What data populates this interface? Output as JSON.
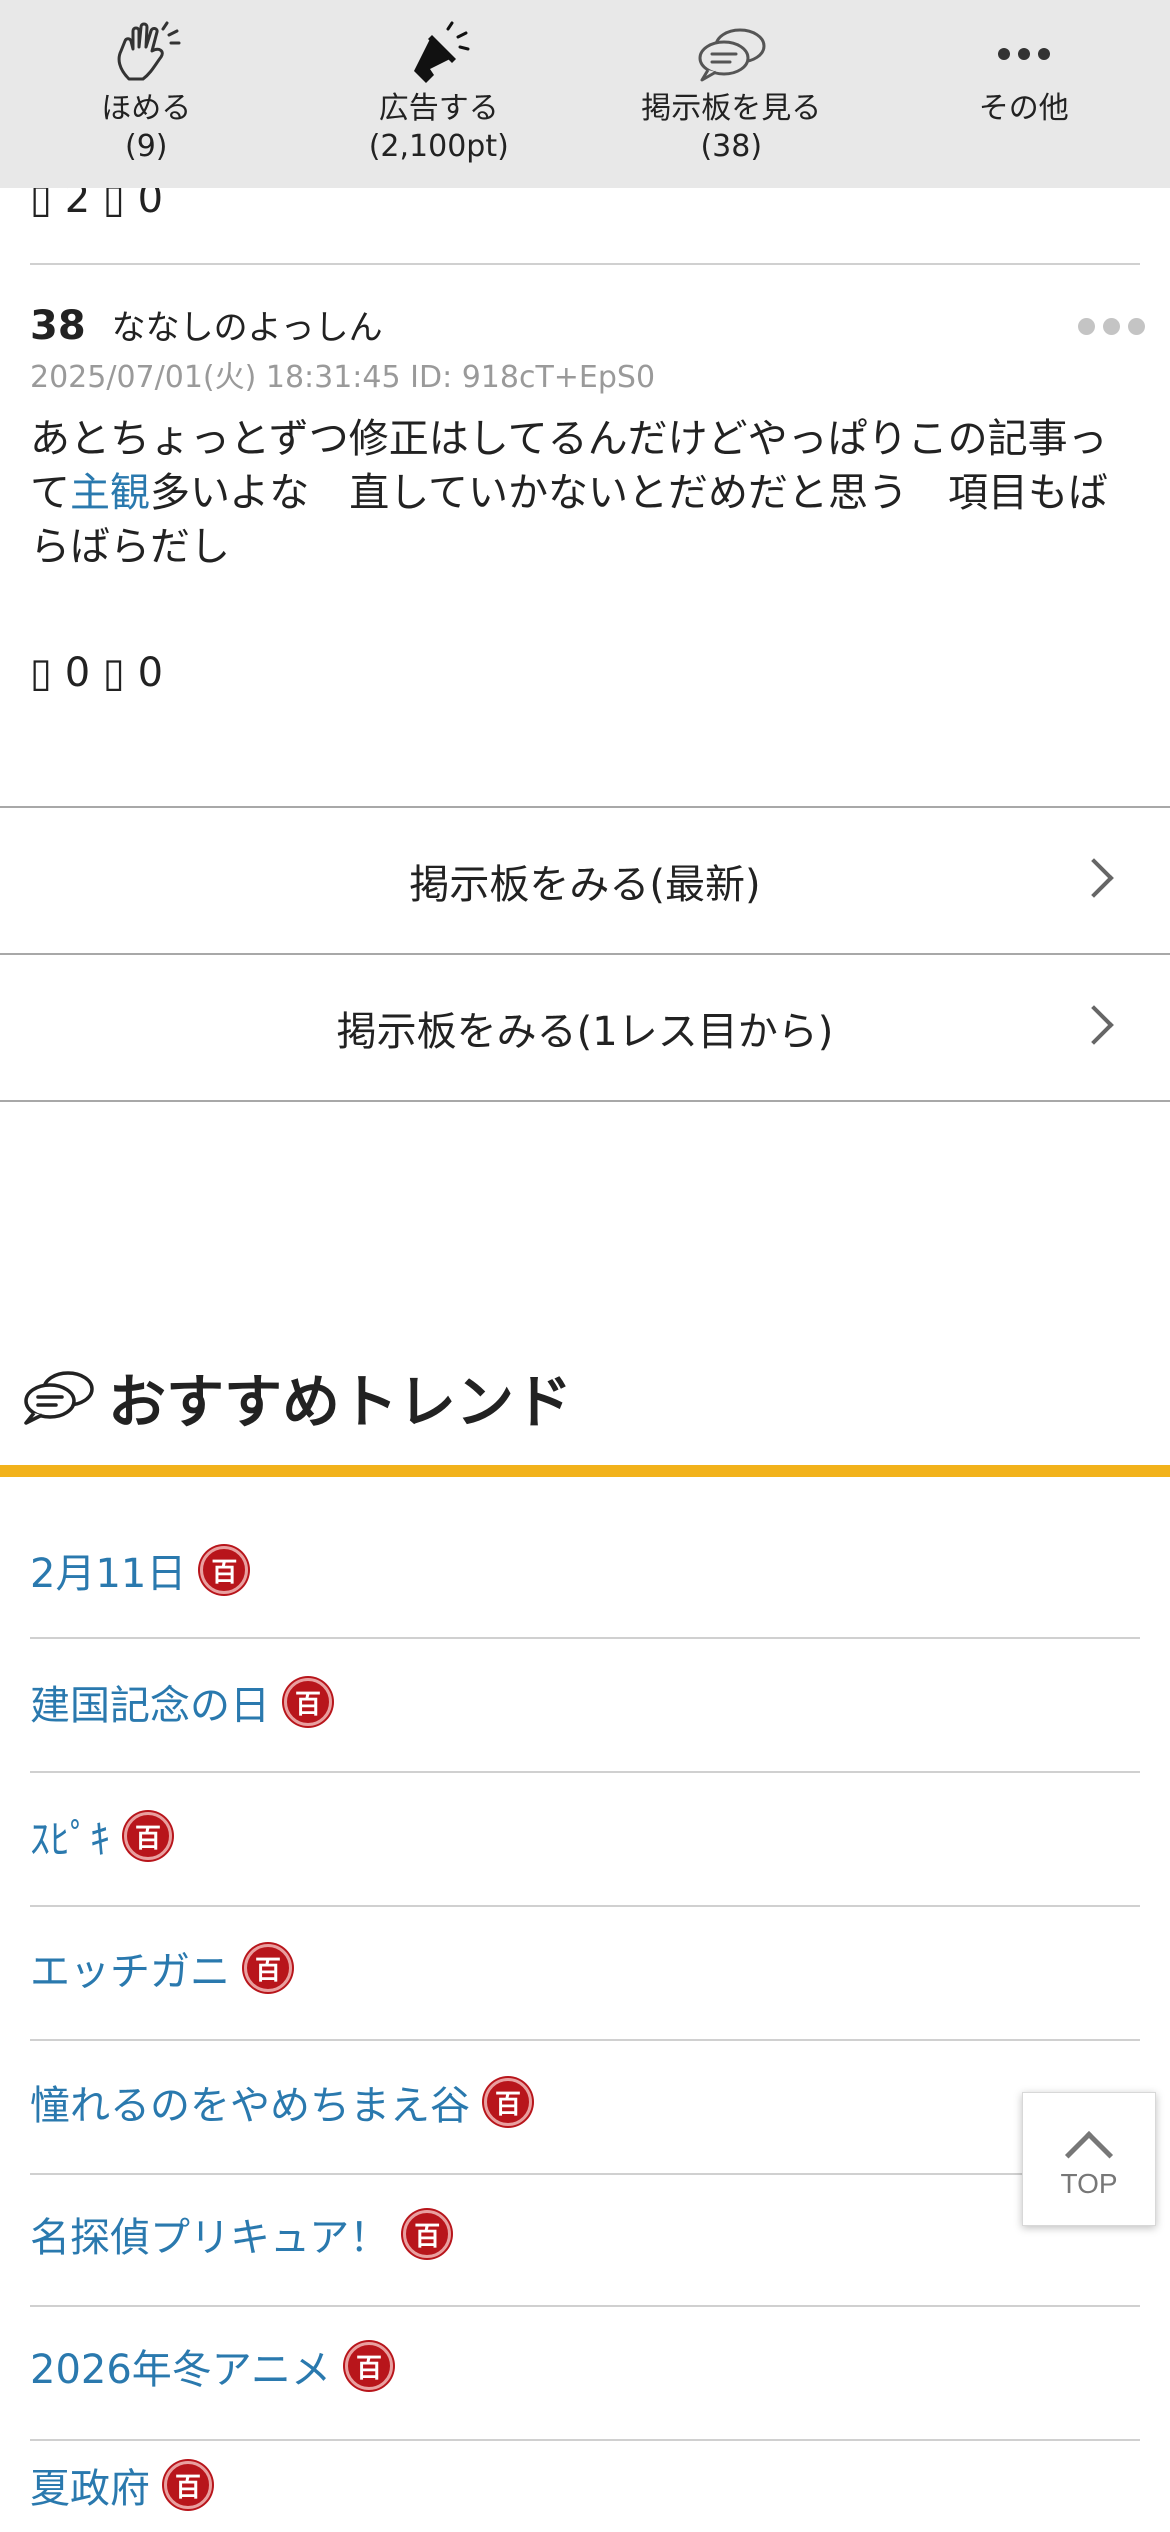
{
  "action_bar": {
    "items": [
      {
        "label_line1": "ほめる",
        "label_line2": "(9)",
        "icon": "clapping-hands-icon"
      },
      {
        "label_line1": "広告する",
        "label_line2": "(2,100pt)",
        "icon": "megaphone-icon"
      },
      {
        "label_line1": "掲示板を見る",
        "label_line2": "(38)",
        "icon": "chat-bubbles-icon"
      },
      {
        "label_line1": "その他",
        "label_line2": "",
        "icon": "more-dots-icon"
      }
    ]
  },
  "previous_comment": {
    "reactions": "▯ 2 ▯ 0"
  },
  "comment": {
    "number": "38",
    "name": "ななしのよっしん",
    "meta": "2025/07/01(火) 18:31:45 ID: 918cT+EpS0",
    "body_before_link": "あとちょっとずつ修正はしてるんだけどやっぱりこの記事って",
    "body_link": "主観",
    "body_after_link": "多いよな　直していかないとだめだと思う　項目もばらばらだし",
    "reactions": "▯ 0 ▯ 0"
  },
  "board_links": {
    "latest": "掲示板をみる(最新)",
    "from_first": "掲示板をみる(1レス目から)"
  },
  "trends": {
    "title": "おすすめトレンド",
    "badge_label": "百",
    "items": [
      "2月11日",
      "建国記念の日",
      "ｽﾋﾟｷ",
      "エッチガニ",
      "憧れるのをやめちまえ谷",
      "名探偵プリキュア！",
      "2026年冬アニメ",
      "夏政府"
    ]
  },
  "top_button": {
    "label": "TOP"
  },
  "colors": {
    "link": "#2a79ae",
    "accent_bar": "#f2b21b",
    "badge": "#b8151b"
  }
}
